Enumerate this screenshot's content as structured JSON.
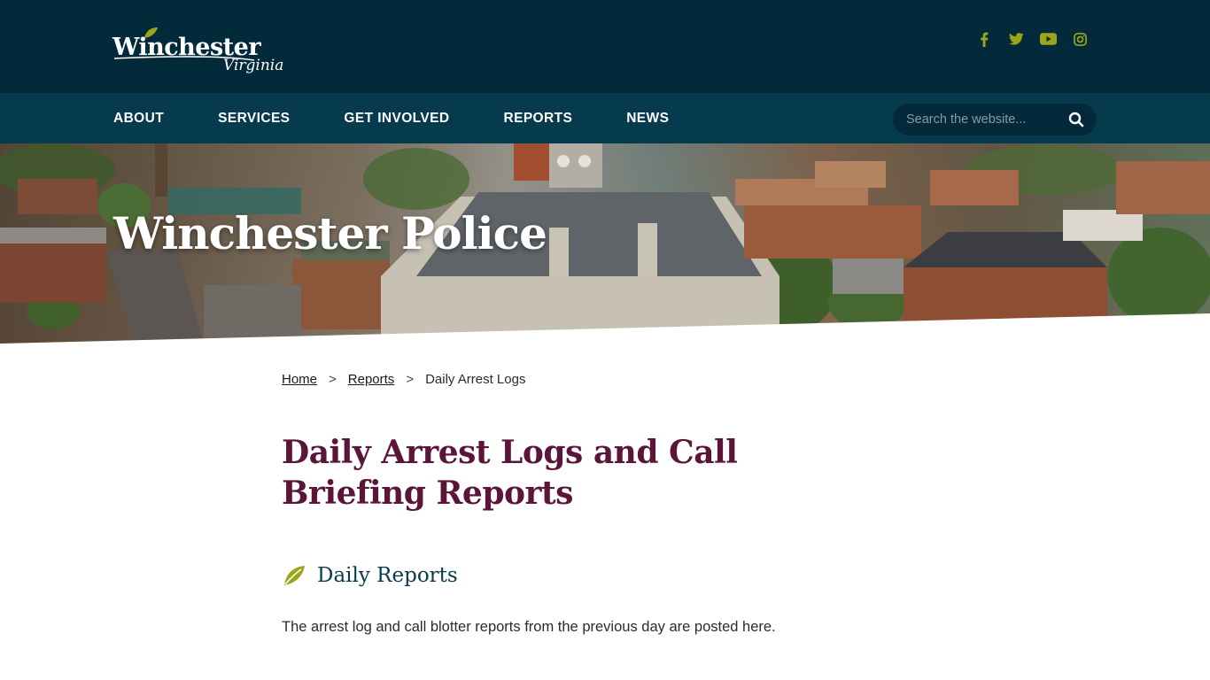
{
  "colors": {
    "topbar": "#032a3b",
    "navbar": "#063a4d",
    "accent_green": "#9aa618",
    "title_maroon": "#5a1538",
    "heading_navy": "#063a4d"
  },
  "header": {
    "logo_word": "Winchester",
    "logo_sub": "Virginia",
    "social": [
      {
        "icon": "facebook-icon"
      },
      {
        "icon": "twitter-icon"
      },
      {
        "icon": "youtube-icon"
      },
      {
        "icon": "instagram-icon"
      }
    ]
  },
  "nav": {
    "items": [
      "ABOUT",
      "SERVICES",
      "GET INVOLVED",
      "REPORTS",
      "NEWS"
    ],
    "search_placeholder": "Search the website..."
  },
  "hero": {
    "title": "Winchester Police"
  },
  "breadcrumb": {
    "home": "Home",
    "sep1": ">",
    "reports": "Reports",
    "sep2": ">",
    "current": "Daily Arrest Logs"
  },
  "main": {
    "page_title": "Daily Arrest Logs and Call Briefing Reports",
    "section_title": "Daily Reports",
    "intro": "The arrest log and call blotter reports from the previous day are posted here."
  }
}
